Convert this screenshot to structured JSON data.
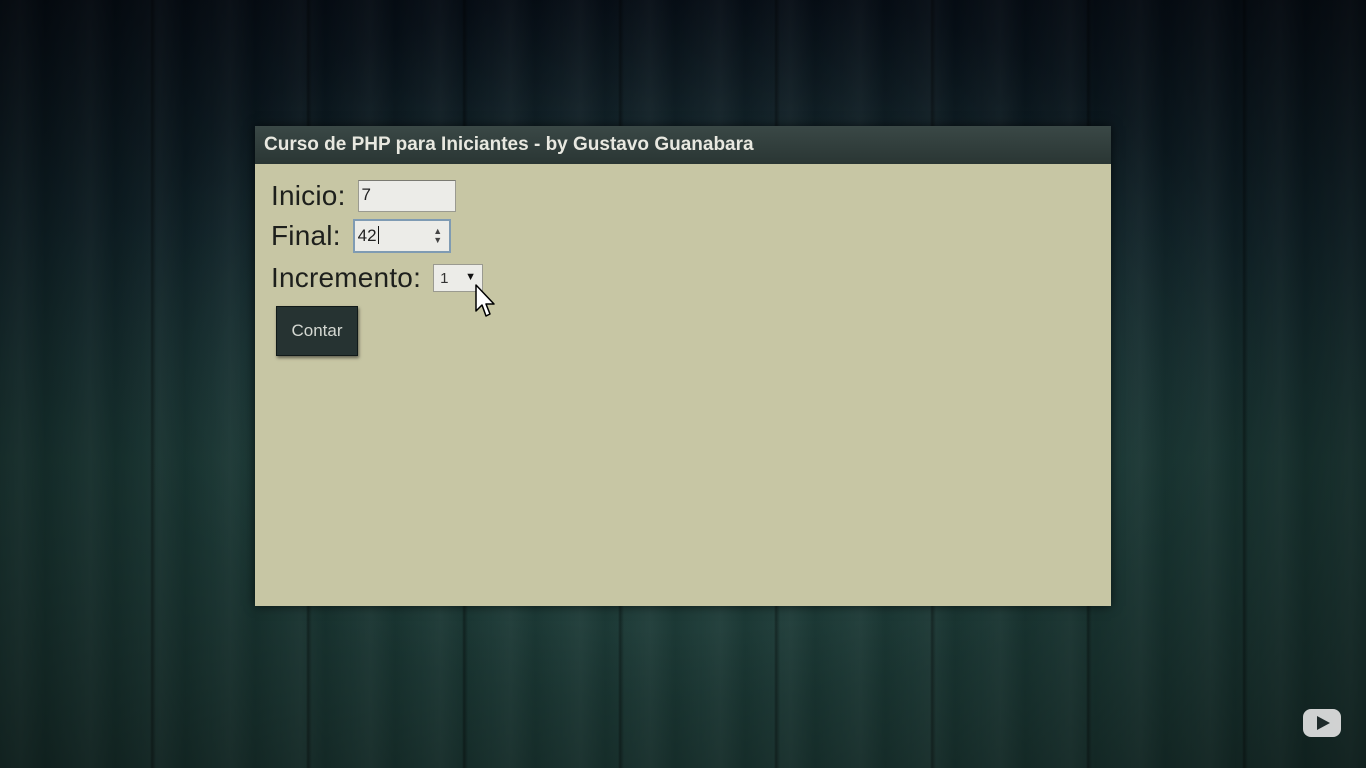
{
  "window": {
    "title": "Curso de PHP para Iniciantes - by Gustavo Guanabara"
  },
  "form": {
    "inicio": {
      "label": "Inicio:",
      "value": "7"
    },
    "final": {
      "label": "Final:",
      "value": "42"
    },
    "incremento": {
      "label": "Incremento:",
      "selected": "1"
    },
    "submit_label": "Contar"
  },
  "icons": {
    "spinner": "number-spinner-icon",
    "dropdown": "chevron-down-icon",
    "pointer": "mouse-pointer-icon",
    "video": "youtube-play-icon"
  },
  "colors": {
    "window_bg": "#c7c6a4",
    "titlebar_bg": "#2f3b3a",
    "button_bg": "#263332",
    "focus_border": "#7f9bb3"
  }
}
